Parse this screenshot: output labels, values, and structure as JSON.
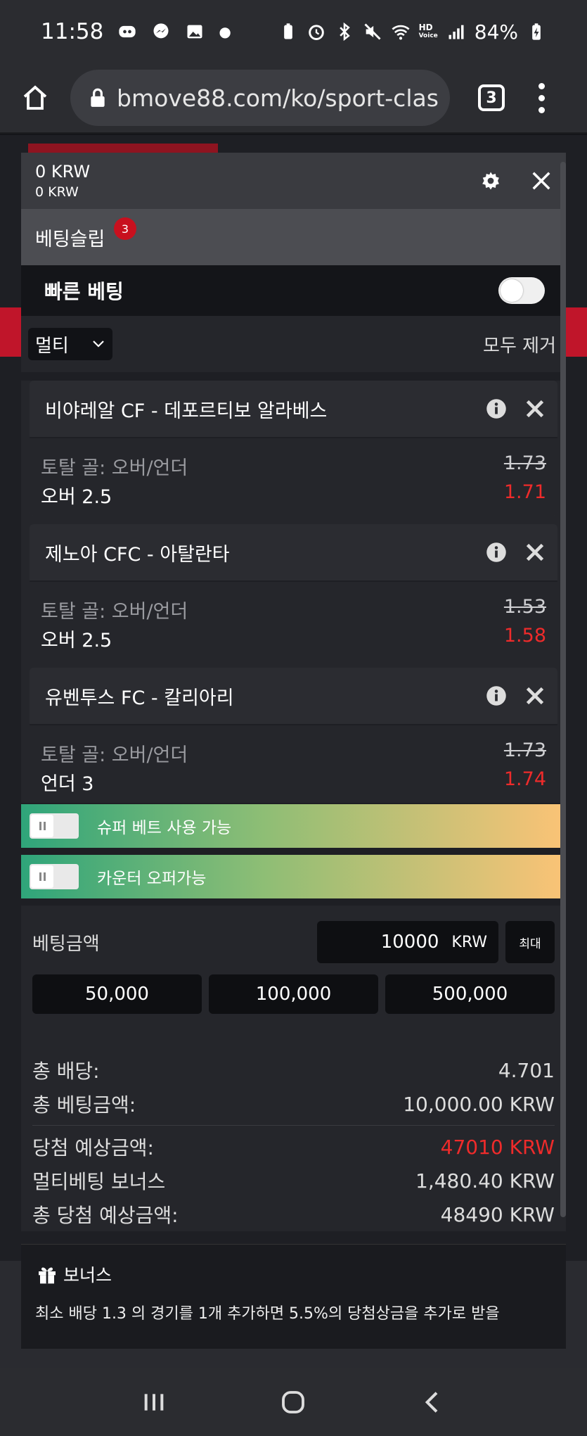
{
  "status_bar": {
    "time": "11:58",
    "battery": "84%",
    "network": "HD",
    "network_sub": "Voice"
  },
  "browser": {
    "url": "bmove88.com/ko/sport-clas",
    "tab_count": "3"
  },
  "slip": {
    "balance_primary": "0 KRW",
    "balance_secondary": "0 KRW",
    "title": "베팅슬립",
    "badge_count": "3",
    "quick_bet_label": "빠른 베팅",
    "mode_selected": "멀티",
    "remove_all": "모두 제거",
    "bets": [
      {
        "match": "비야레알 CF - 데포르티보 알라베스",
        "market": "토탈 골: 오버/언더",
        "selection": "오버 2.5",
        "old_odds": "1.73",
        "new_odds": "1.71"
      },
      {
        "match": "제노아 CFC - 아탈란타",
        "market": "토탈 골: 오버/언더",
        "selection": "오버 2.5",
        "old_odds": "1.53",
        "new_odds": "1.58"
      },
      {
        "match": "유벤투스 FC - 칼리아리",
        "market": "토탈 골: 오버/언더",
        "selection": "언더 3",
        "old_odds": "1.73",
        "new_odds": "1.74"
      }
    ],
    "promo_superbet": "슈퍼 베트 사용 가능",
    "promo_counter": "카운터 오퍼가능",
    "amount_label": "베팅금액",
    "amount_value": "10000",
    "amount_currency": "KRW",
    "max_label": "최대",
    "quick_amounts": [
      "50,000",
      "100,000",
      "500,000"
    ],
    "summary": {
      "total_odds_label": "총 배당:",
      "total_odds": "4.701",
      "total_stake_label": "총 베팅금액:",
      "total_stake": "10,000.00 KRW",
      "expected_win_label": "당첨 예상금액:",
      "expected_win": "47010 KRW",
      "multi_bonus_label": "멀티베팅 보너스",
      "multi_bonus": "1,480.40 KRW",
      "total_expected_label": "총 당첨 예상금액:",
      "total_expected": "48490 KRW"
    },
    "bonus_title": "보너스",
    "bonus_text": "최소 배당 1.3 의 경기를 1개 추가하면 5.5%의 당첨상금을 추가로 받을"
  },
  "colors": {
    "odds_red": "#ee2b2b",
    "promo_start": "#2fa57a",
    "promo_end": "#fbc376",
    "badge": "#c8101e"
  }
}
